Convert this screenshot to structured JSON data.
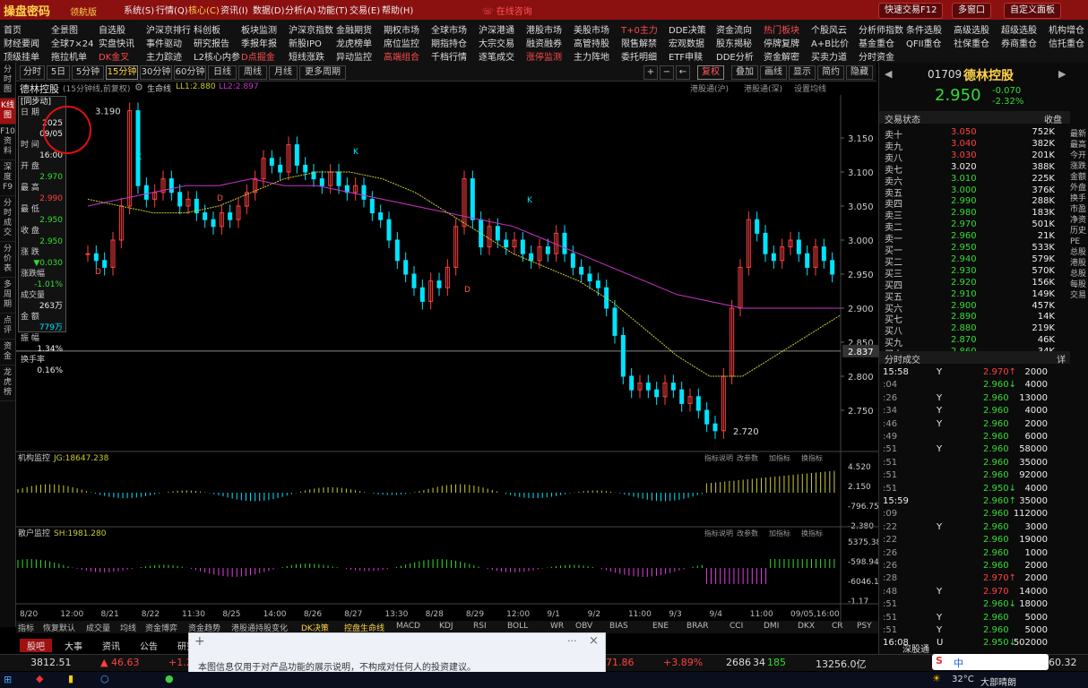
{
  "app": {
    "title": "操盘密码",
    "edition": "领航版",
    "menu": [
      "系统(S)",
      "行情(Q)",
      "核心(C)",
      "资讯(I)",
      "数据(D)",
      "分析(A)",
      "功能(T)",
      "交易(E)",
      "帮助(H)"
    ],
    "online_consult": "在线咨询",
    "right_buttons": [
      "快速交易F12",
      "多窗口",
      "自定义面板"
    ]
  },
  "nav": {
    "row1": [
      "首页",
      "全景图",
      "自选股",
      "沪深京排行",
      "科创板",
      "板块监测",
      "沪深京指数",
      "金融期货",
      "期权市场",
      "全球市场",
      "沪深港通",
      "港股市场",
      "美股市场",
      "T+0主力",
      "DDE决策",
      "资金流向",
      "热门板块",
      "个股风云",
      "分析师指数",
      "条件选股",
      "高级选股",
      "超级选股",
      "机构增仓"
    ],
    "row2": [
      "财经要闻",
      "全球7×24",
      "实盘快讯",
      "事件驱动",
      "研究报告",
      "季报年报",
      "新股IPO",
      "龙虎榜单",
      "席位监控",
      "期指持仓",
      "大宗交易",
      "融资融券",
      "高管持股",
      "限售解禁",
      "宏观数据",
      "股东揭秘",
      "停牌复牌",
      "A+B比价",
      "基金重仓",
      "QFII重仓",
      "社保重仓",
      "券商重仓",
      "信托重仓"
    ],
    "row3": [
      "顶级挂单",
      "拖拉机单",
      "DK金叉",
      "主力踪迹",
      "L2核心内参",
      "D点掘金",
      "短线涨跌",
      "异动监控",
      "高端组合",
      "千档行情",
      "逐笔成交",
      "涨停监测",
      "主力阵地",
      "委托明细",
      "ETF申赎",
      "DDE分析",
      "资金解密",
      "买卖力道",
      "分时资金"
    ],
    "row1_highlight": [
      "T+0主力",
      "热门板块"
    ],
    "row3_highlight": [
      "DK金叉",
      "D点掘金",
      "高端组合",
      "涨停监测"
    ]
  },
  "left_tabs": [
    "分时图",
    "K线图",
    "F10资料",
    "深度F9",
    "分时成交",
    "分价表",
    "多周期",
    "点评",
    "资金",
    "龙虎榜"
  ],
  "periods": {
    "items": [
      "分时",
      "5日",
      "5分钟",
      "15分钟",
      "30分钟",
      "60分钟",
      "日线",
      "周线",
      "月线",
      "更多周期"
    ],
    "selected": "15分钟",
    "right_items": [
      "复权",
      "叠加",
      "画线",
      "显示",
      "简约",
      "隐藏"
    ]
  },
  "stock_bar": {
    "name": "德林控股",
    "period": "(15分钟线,前复权)",
    "indicator": "生命线",
    "ll1": "LL1:2.880",
    "ll2": "LL2:2.897",
    "links": [
      "港股通(沪)",
      "港股通(深)",
      "设置均线"
    ]
  },
  "info_box": {
    "mode": "[同步动]",
    "date_label": "日  期",
    "date_year": "2025",
    "date_md": "09/05",
    "time_label": "时  间",
    "time": "16:00",
    "open_label": "开  盘",
    "open": "2.970",
    "high_label": "最  高",
    "high": "2.990",
    "low_label": "最  低",
    "low": "2.950",
    "close_label": "收  盘",
    "close": "2.950",
    "chg_label": "涨  跌",
    "chg": "▼0.030",
    "pct_label": "涨跌幅",
    "pct": "-1.01%",
    "vol_label": "成交量",
    "vol": "263万",
    "amt_label": "金  额",
    "amt": "779万",
    "amp_label": "振  幅",
    "amp": "1.34%",
    "turn_label": "换手率",
    "turn": "0.16%"
  },
  "chart_data": {
    "type": "candlestick",
    "price_axis": [
      "3.150",
      "3.100",
      "3.050",
      "3.000",
      "2.950",
      "2.900",
      "2.850",
      "2.800",
      "2.750"
    ],
    "current_line": "2.837",
    "ylim": [
      2.7,
      3.2
    ],
    "annotations": {
      "high": "3.190",
      "low": "2.720"
    },
    "markers": [
      "D",
      "K",
      "D",
      "K",
      "D",
      "K"
    ],
    "x_labels": [
      "8/20",
      "12:00",
      "8/21",
      "8/22",
      "11:30",
      "8/25",
      "14:00",
      "8/26",
      "8/27",
      "13:30",
      "8/28",
      "8/29",
      "12:00",
      "9/1",
      "9/2",
      "11:00",
      "9/3",
      "9/4",
      "11:00",
      "09/05,16:00"
    ],
    "close_series": [
      2.98,
      2.97,
      2.96,
      3.0,
      3.05,
      3.19,
      3.08,
      3.06,
      3.07,
      3.09,
      3.07,
      3.05,
      3.06,
      3.04,
      3.03,
      3.02,
      3.04,
      3.03,
      3.05,
      3.07,
      3.09,
      3.12,
      3.11,
      3.1,
      3.14,
      3.11,
      3.1,
      3.09,
      3.08,
      3.1,
      3.08,
      3.07,
      3.08,
      3.06,
      3.04,
      3.03,
      3.0,
      2.97,
      2.95,
      2.93,
      2.91,
      2.94,
      2.93,
      2.96,
      3.02,
      3.09,
      3.03,
      2.99,
      3.02,
      3.0,
      2.99,
      3.0,
      2.98,
      2.97,
      2.99,
      2.98,
      3.01,
      2.98,
      2.96,
      2.95,
      2.94,
      2.93,
      2.9,
      2.86,
      2.8,
      2.78,
      2.79,
      2.78,
      2.77,
      2.79,
      2.78,
      2.76,
      2.77,
      2.75,
      2.73,
      2.72,
      2.8,
      2.9,
      2.96,
      3.03,
      3.01,
      2.98,
      2.97,
      2.99,
      3.0,
      2.98,
      2.96,
      2.99,
      2.97,
      2.95
    ],
    "ma_purple": [
      3.05,
      3.06,
      3.07,
      3.08,
      3.08,
      3.09,
      3.08,
      3.08,
      3.07,
      3.06,
      3.05,
      3.04,
      3.03,
      3.02,
      3.0,
      2.98,
      2.96,
      2.94,
      2.92,
      2.91,
      2.9,
      2.9,
      2.9,
      2.9
    ],
    "ma_yellow": [
      3.06,
      3.05,
      3.04,
      3.04,
      3.05,
      3.07,
      3.09,
      3.1,
      3.1,
      3.09,
      3.07,
      3.04,
      3.01,
      2.98,
      2.96,
      2.94,
      2.91,
      2.87,
      2.83,
      2.8,
      2.8,
      2.83,
      2.86,
      2.89
    ],
    "panels": [
      {
        "name": "机构监控",
        "value": "JG:18647.238",
        "axis": [
          "4.520",
          "2.150",
          "-796.750",
          "-2.380"
        ]
      },
      {
        "name": "散户监控",
        "value": "SH:1981.280",
        "axis": [
          "5375.38",
          "-598.94",
          "-6046.13",
          "-1.17"
        ]
      }
    ],
    "panel_links": [
      "指标说明",
      "改参数",
      "加指标",
      "换指标"
    ]
  },
  "indicator_tabs": [
    "指标",
    "恢复默认",
    "成交量",
    "均线",
    "资金博弈",
    "资金趋势",
    "港股通持股变化",
    "DK决策",
    "控盘生命线",
    "MACD",
    "KDJ",
    "RSI",
    "BOLL",
    "WR",
    "OBV",
    "BIAS",
    "ENE",
    "BRAR",
    "CCI",
    "DMI",
    "DKX",
    "CR",
    "PSY",
    "更多",
    "模板"
  ],
  "bottom_tabs": [
    "股吧",
    "大事",
    "资讯",
    "公告",
    "研究"
  ],
  "quote": {
    "code": "01709",
    "name": "德林控股",
    "price": "2.950",
    "change": "-0.070",
    "pct": "-2.32%",
    "book_label": "交易状态",
    "close_label": "收盘",
    "asks": [
      {
        "lbl": "卖十",
        "px": "3.050",
        "vol": "752K"
      },
      {
        "lbl": "卖九",
        "px": "3.040",
        "vol": "382K"
      },
      {
        "lbl": "卖八",
        "px": "3.030",
        "vol": "201K"
      },
      {
        "lbl": "卖七",
        "px": "3.020",
        "vol": "388K"
      },
      {
        "lbl": "卖六",
        "px": "3.010",
        "vol": "225K"
      },
      {
        "lbl": "卖五",
        "px": "3.000",
        "vol": "376K"
      },
      {
        "lbl": "卖四",
        "px": "2.990",
        "vol": "288K"
      },
      {
        "lbl": "卖三",
        "px": "2.980",
        "vol": "183K"
      },
      {
        "lbl": "卖二",
        "px": "2.970",
        "vol": "501K"
      },
      {
        "lbl": "卖一",
        "px": "2.960",
        "vol": "21K"
      }
    ],
    "bids": [
      {
        "lbl": "买一",
        "px": "2.950",
        "vol": "533K"
      },
      {
        "lbl": "买二",
        "px": "2.940",
        "vol": "579K"
      },
      {
        "lbl": "买三",
        "px": "2.930",
        "vol": "570K"
      },
      {
        "lbl": "买四",
        "px": "2.920",
        "vol": "156K"
      },
      {
        "lbl": "买五",
        "px": "2.910",
        "vol": "149K"
      },
      {
        "lbl": "买六",
        "px": "2.900",
        "vol": "457K"
      },
      {
        "lbl": "买七",
        "px": "2.890",
        "vol": "14K"
      },
      {
        "lbl": "买八",
        "px": "2.880",
        "vol": "219K"
      },
      {
        "lbl": "买九",
        "px": "2.870",
        "vol": "46K"
      },
      {
        "lbl": "买十",
        "px": "2.860",
        "vol": "34K"
      }
    ],
    "ticks_label": "分时成交",
    "ticks_more": "详",
    "ticks": [
      {
        "t": "15:58",
        "f": "Y",
        "p": "2.970↑",
        "v": "2000"
      },
      {
        "t": ":04",
        "f": "",
        "p": "2.960↓",
        "v": "4000"
      },
      {
        "t": ":26",
        "f": "Y",
        "p": "2.960",
        "v": "13000"
      },
      {
        "t": ":34",
        "f": "Y",
        "p": "2.960",
        "v": "4000"
      },
      {
        "t": ":46",
        "f": "Y",
        "p": "2.960",
        "v": "2000"
      },
      {
        "t": ":49",
        "f": "",
        "p": "2.960",
        "v": "6000"
      },
      {
        "t": ":51",
        "f": "Y",
        "p": "2.960",
        "v": "58000"
      },
      {
        "t": ":51",
        "f": "",
        "p": "2.960",
        "v": "35000"
      },
      {
        "t": ":51",
        "f": "",
        "p": "2.960",
        "v": "92000"
      },
      {
        "t": ":51",
        "f": "",
        "p": "2.950↓",
        "v": "4000"
      },
      {
        "t": "15:59",
        "f": "",
        "p": "2.960↑",
        "v": "35000"
      },
      {
        "t": ":09",
        "f": "",
        "p": "2.960",
        "v": "112000"
      },
      {
        "t": ":22",
        "f": "Y",
        "p": "2.960",
        "v": "3000"
      },
      {
        "t": ":22",
        "f": "",
        "p": "2.960",
        "v": "19000"
      },
      {
        "t": ":26",
        "f": "",
        "p": "2.960",
        "v": "1000"
      },
      {
        "t": ":26",
        "f": "",
        "p": "2.960",
        "v": "2000"
      },
      {
        "t": ":28",
        "f": "",
        "p": "2.970↑",
        "v": "2000"
      },
      {
        "t": ":48",
        "f": "Y",
        "p": "2.970",
        "v": "14000"
      },
      {
        "t": ":51",
        "f": "",
        "p": "2.960↓",
        "v": "18000"
      },
      {
        "t": ":51",
        "f": "Y",
        "p": "2.960",
        "v": "5000"
      },
      {
        "t": ":51",
        "f": "Y",
        "p": "2.960",
        "v": "5000"
      },
      {
        "t": "16:08",
        "f": "U",
        "p": "2.950↓",
        "v": "502000"
      }
    ],
    "depth_label": "深股通"
  },
  "far_right": [
    "最新",
    "最高",
    "今开",
    "涨跌",
    "金额",
    "外盘",
    "换手",
    "市盈",
    "净资",
    "历史",
    "PE",
    "总股",
    "港股",
    "总股",
    "每股",
    "交易"
  ],
  "status": {
    "index1": "3812.51",
    "chg1": "▲ 46.63",
    "chg1b": "+1.2",
    "mid1": "71.86",
    "mid2": "+3.89%",
    "mid3": "2686",
    "mid4": "34",
    "mid5": "185",
    "mid6": "13256.0亿",
    "right": "60.32"
  },
  "popup": {
    "text": "本图信息仅用于对产品功能的展示说明，不构成对任何人的投资建议。",
    "plus": "+",
    "dots": "···",
    "close": "×"
  },
  "taskbar": {
    "weather": "32°C",
    "weather_text": "大部晴朗",
    "ime": "中"
  },
  "colors": {
    "up": "#ff4040",
    "down": "#00e5ff",
    "ma1": "#cc33cc",
    "ma2": "#cccc33",
    "brand": "#8b1010"
  }
}
